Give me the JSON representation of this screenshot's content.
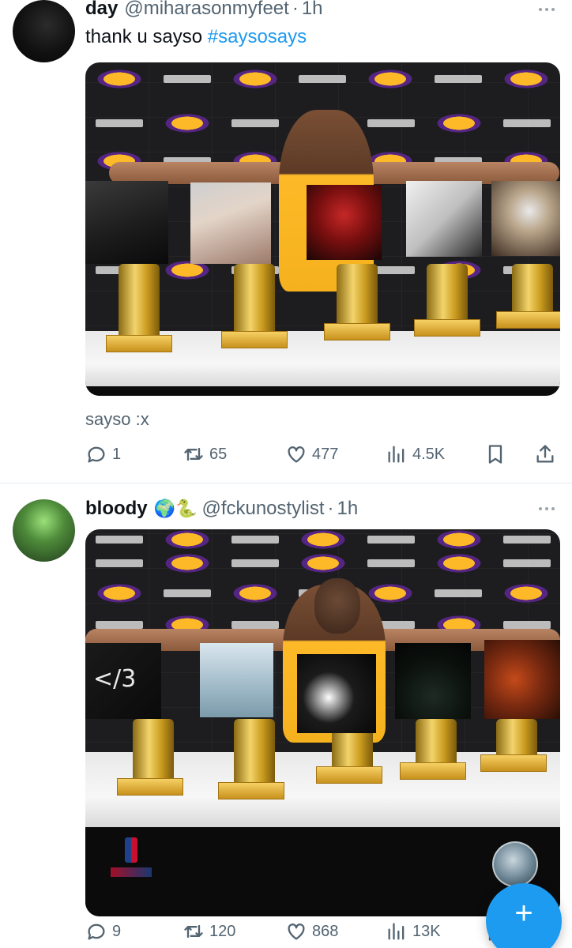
{
  "tweets": [
    {
      "display_name": "day",
      "handle": "@miharasonmyfeet",
      "separator": "·",
      "time": "1h",
      "text": "thank u sayso ",
      "hashtag": "#saysosays",
      "caption": "sayso :x",
      "replies": "1",
      "retweets": "65",
      "likes": "477",
      "views": "4.5K"
    },
    {
      "display_name": "bloody",
      "emojis": "🌍🐍",
      "handle": "@fckunostylist",
      "separator": "·",
      "time": "1h",
      "cover_text": "</3",
      "replies": "9",
      "retweets": "120",
      "likes": "868",
      "views": "13K"
    }
  ],
  "icons": [
    "more-icon",
    "reply-icon",
    "retweet-icon",
    "like-icon",
    "views-icon",
    "bookmark-icon",
    "share-icon",
    "plus-icon"
  ],
  "colors": {
    "link": "#1d9bf0",
    "muted": "#536471",
    "text": "#0f1419"
  },
  "fab": {
    "label": "+"
  }
}
